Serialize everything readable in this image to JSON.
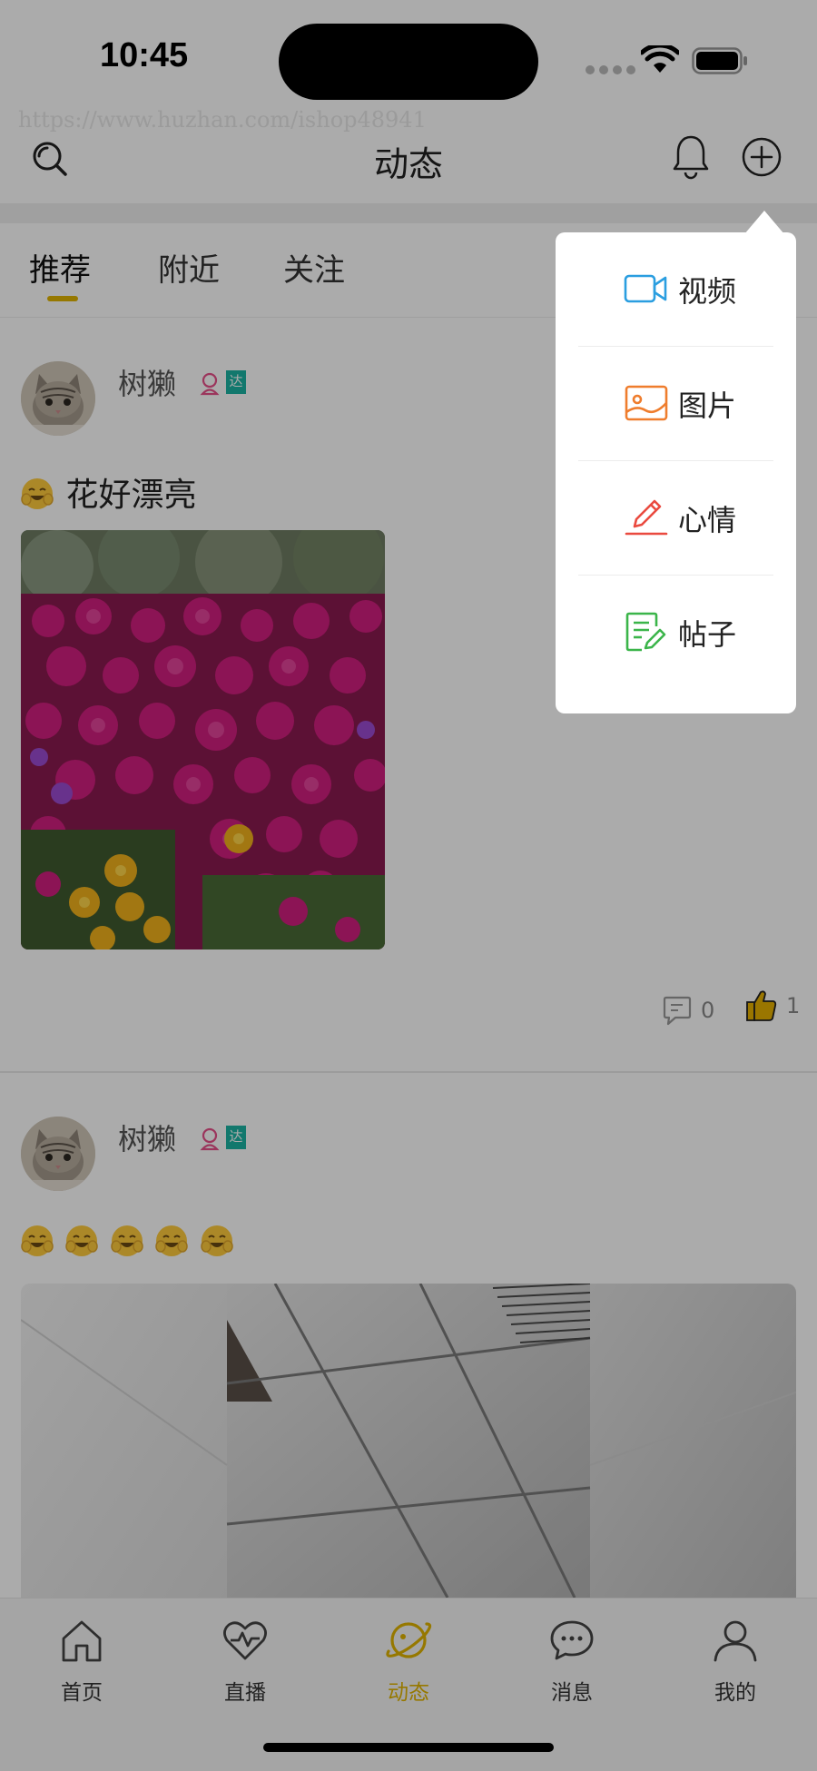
{
  "status_bar": {
    "time": "10:45"
  },
  "watermark": "https://www.huzhan.com/ishop48941",
  "header": {
    "title": "动态"
  },
  "tabs": [
    {
      "label": "推荐",
      "active": true
    },
    {
      "label": "附近",
      "active": false
    },
    {
      "label": "关注",
      "active": false
    }
  ],
  "posts": [
    {
      "username": "树獭",
      "badge": "达",
      "text": "花好漂亮",
      "comments": "0",
      "likes": "1"
    },
    {
      "username": "树獭",
      "badge": "达"
    }
  ],
  "popup_menu": {
    "items": [
      {
        "label": "视频",
        "icon": "video-camera-icon",
        "color": "#2a9ee0"
      },
      {
        "label": "图片",
        "icon": "image-icon",
        "color": "#ef7d2d"
      },
      {
        "label": "心情",
        "icon": "pen-icon",
        "color": "#ea4a3f"
      },
      {
        "label": "帖子",
        "icon": "note-edit-icon",
        "color": "#3bb54a"
      }
    ]
  },
  "bottom_nav": [
    {
      "label": "首页",
      "icon": "home-icon"
    },
    {
      "label": "直播",
      "icon": "heartbeat-icon"
    },
    {
      "label": "动态",
      "icon": "planet-icon",
      "active": true
    },
    {
      "label": "消息",
      "icon": "chat-bubble-icon"
    },
    {
      "label": "我的",
      "icon": "user-icon"
    }
  ],
  "colors": {
    "accent": "#e0b400",
    "badge_teal": "#1bb3a3",
    "gender_pink": "#e8508a",
    "overlay": "rgba(0,0,0,0.33)"
  }
}
